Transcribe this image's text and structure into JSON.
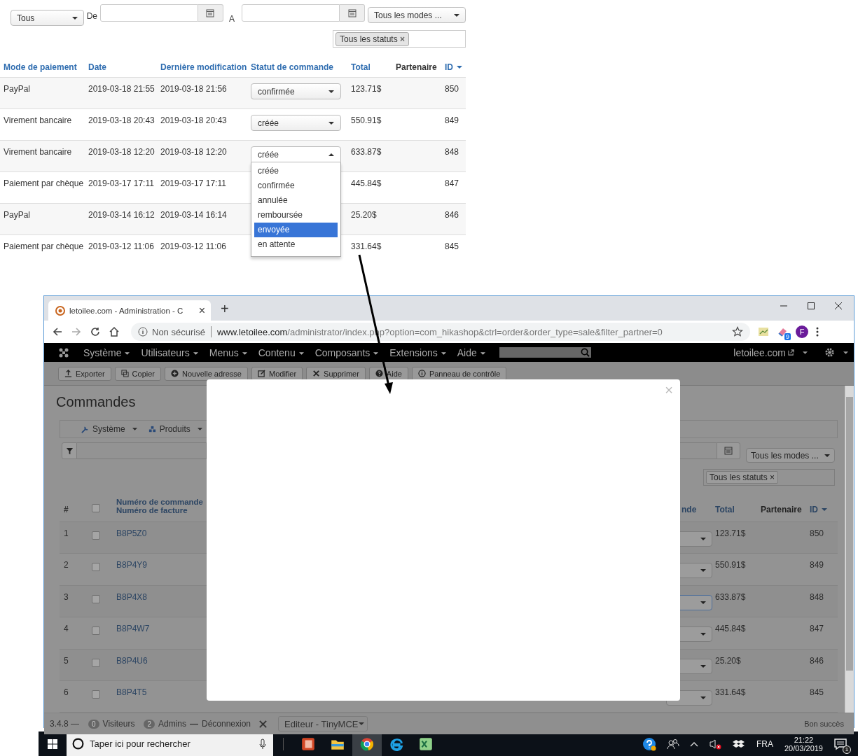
{
  "top_panel": {
    "filters": {
      "period_select": "Tous",
      "from_label": "De",
      "to_label": "A",
      "payment_select": "Tous les modes ...",
      "status_tag": "Tous les statuts",
      "status_tag_remove": "×"
    },
    "table": {
      "columns": [
        {
          "label": "Mode de paiement",
          "link": true,
          "sorted": false
        },
        {
          "label": "Date",
          "link": true,
          "sorted": false
        },
        {
          "label": "Dernière modification",
          "link": true,
          "sorted": false
        },
        {
          "label": "Statut de commande",
          "link": true,
          "sorted": false
        },
        {
          "label": "Total",
          "link": true,
          "sorted": false
        },
        {
          "label": "Partenaire",
          "link": false,
          "sorted": false
        },
        {
          "label": "ID",
          "link": true,
          "sorted": true
        }
      ],
      "rows": [
        {
          "payment": "PayPal",
          "date": "2019-03-18 21:55",
          "modified": "2019-03-18 21:56",
          "status": {
            "value": "confirmée",
            "expanded": false
          },
          "total": "123.71$",
          "id": "850"
        },
        {
          "payment": "Virement bancaire",
          "date": "2019-03-18 20:43",
          "modified": "2019-03-18 20:43",
          "status": {
            "value": "créée",
            "expanded": false
          },
          "total": "550.91$",
          "id": "849"
        },
        {
          "payment": "Virement bancaire",
          "date": "2019-03-18 12:20",
          "modified": "2019-03-18 12:20",
          "status": {
            "value": "créée",
            "expanded": true,
            "options": [
              {
                "label": "créée",
                "highlighted": false
              },
              {
                "label": "confirmée",
                "highlighted": false
              },
              {
                "label": "annulée",
                "highlighted": false
              },
              {
                "label": "remboursée",
                "highlighted": false
              },
              {
                "label": "envoyée",
                "highlighted": true
              },
              {
                "label": "en attente",
                "highlighted": false
              }
            ]
          },
          "total": "633.87$",
          "id": "848"
        },
        {
          "payment": "Paiement par chèque",
          "date": "2019-03-17 17:11",
          "modified": "2019-03-17 17:11",
          "total": "445.84$",
          "id": "847"
        },
        {
          "payment": "PayPal",
          "date": "2019-03-14 16:12",
          "modified": "2019-03-14 16:14",
          "total": "25.20$",
          "id": "846"
        },
        {
          "payment": "Paiement par chèque",
          "date": "2019-03-12 11:06",
          "modified": "2019-03-12 11:06",
          "total": "331.64$",
          "id": "845"
        }
      ]
    }
  },
  "browser": {
    "tab": {
      "title": "letoilee.com - Administration - C",
      "close": "×"
    },
    "new_tab": "+",
    "address_bar": {
      "security": "Non sécurisé",
      "url_domain": "www.letoilee.com",
      "url_path": "/administrator/index.php?option=com_hikashop&ctrl=order&order_type=sale&filter_partner=0"
    },
    "extension_badge": "9",
    "profile": "F"
  },
  "admin": {
    "menu": [
      "Système",
      "Utilisateurs",
      "Menus",
      "Contenu",
      "Composants",
      "Extensions",
      "Aide"
    ],
    "site_link": "letoilee.com",
    "toolbar": [
      {
        "label": "Exporter",
        "kind": "export"
      },
      {
        "label": "Copier",
        "kind": "copy"
      },
      {
        "label": "Nouvelle adresse",
        "kind": "new"
      },
      {
        "label": "Modifier",
        "kind": "edit"
      },
      {
        "label": "Supprimer",
        "kind": "delete"
      },
      {
        "label": "Aide",
        "kind": "help"
      },
      {
        "label": "Panneau de contrôle",
        "kind": "panel"
      }
    ],
    "page_title": "Commandes",
    "submenu": [
      {
        "label": "Système",
        "kind": "system"
      },
      {
        "label": "Produits",
        "kind": "products"
      }
    ],
    "filters": {
      "payment_select": "Tous les modes ...",
      "status_tag": "Tous les statuts",
      "status_tag_remove": "×"
    },
    "table": {
      "select_all_checked": false,
      "index_header": "#",
      "order_header": "Numéro de commande",
      "invoice_header": "Numéro de facture",
      "status_header": "nde",
      "total_header": "Total",
      "partner_header": "Partenaire",
      "id_header": "ID",
      "rows": [
        {
          "index": "1",
          "checked": false,
          "order": "B8P5Z0",
          "focused": false,
          "total": "123.71$",
          "id": "850"
        },
        {
          "index": "2",
          "checked": false,
          "order": "B8P4Y9",
          "focused": false,
          "total": "550.91$",
          "id": "849"
        },
        {
          "index": "3",
          "checked": false,
          "order": "B8P4X8",
          "focused": true,
          "total": "633.87$",
          "id": "848"
        },
        {
          "index": "4",
          "checked": false,
          "order": "B8P4W7",
          "focused": false,
          "total": "445.84$",
          "id": "847"
        },
        {
          "index": "5",
          "checked": false,
          "order": "B8P4U6",
          "focused": false,
          "total": "25.20$",
          "id": "846"
        },
        {
          "index": "6",
          "checked": false,
          "order": "B8P4T5",
          "focused": false,
          "total": "331.64$",
          "id": "845"
        }
      ]
    },
    "modal": {
      "close": "×"
    },
    "footer": {
      "version": "3.4.8 —",
      "visitors_count": "0",
      "visitors_label": "Visiteurs",
      "admins_count": "2",
      "admins_label": "Admins",
      "separator": "—",
      "logout": "Déconnexion",
      "editor_select": "Editeur - TinyMCE",
      "status": "Bon succès"
    }
  },
  "taskbar": {
    "search_placeholder": "Taper ici pour rechercher",
    "language": "FRA",
    "time": "21:22",
    "date": "20/03/2019",
    "notifications": "1"
  }
}
